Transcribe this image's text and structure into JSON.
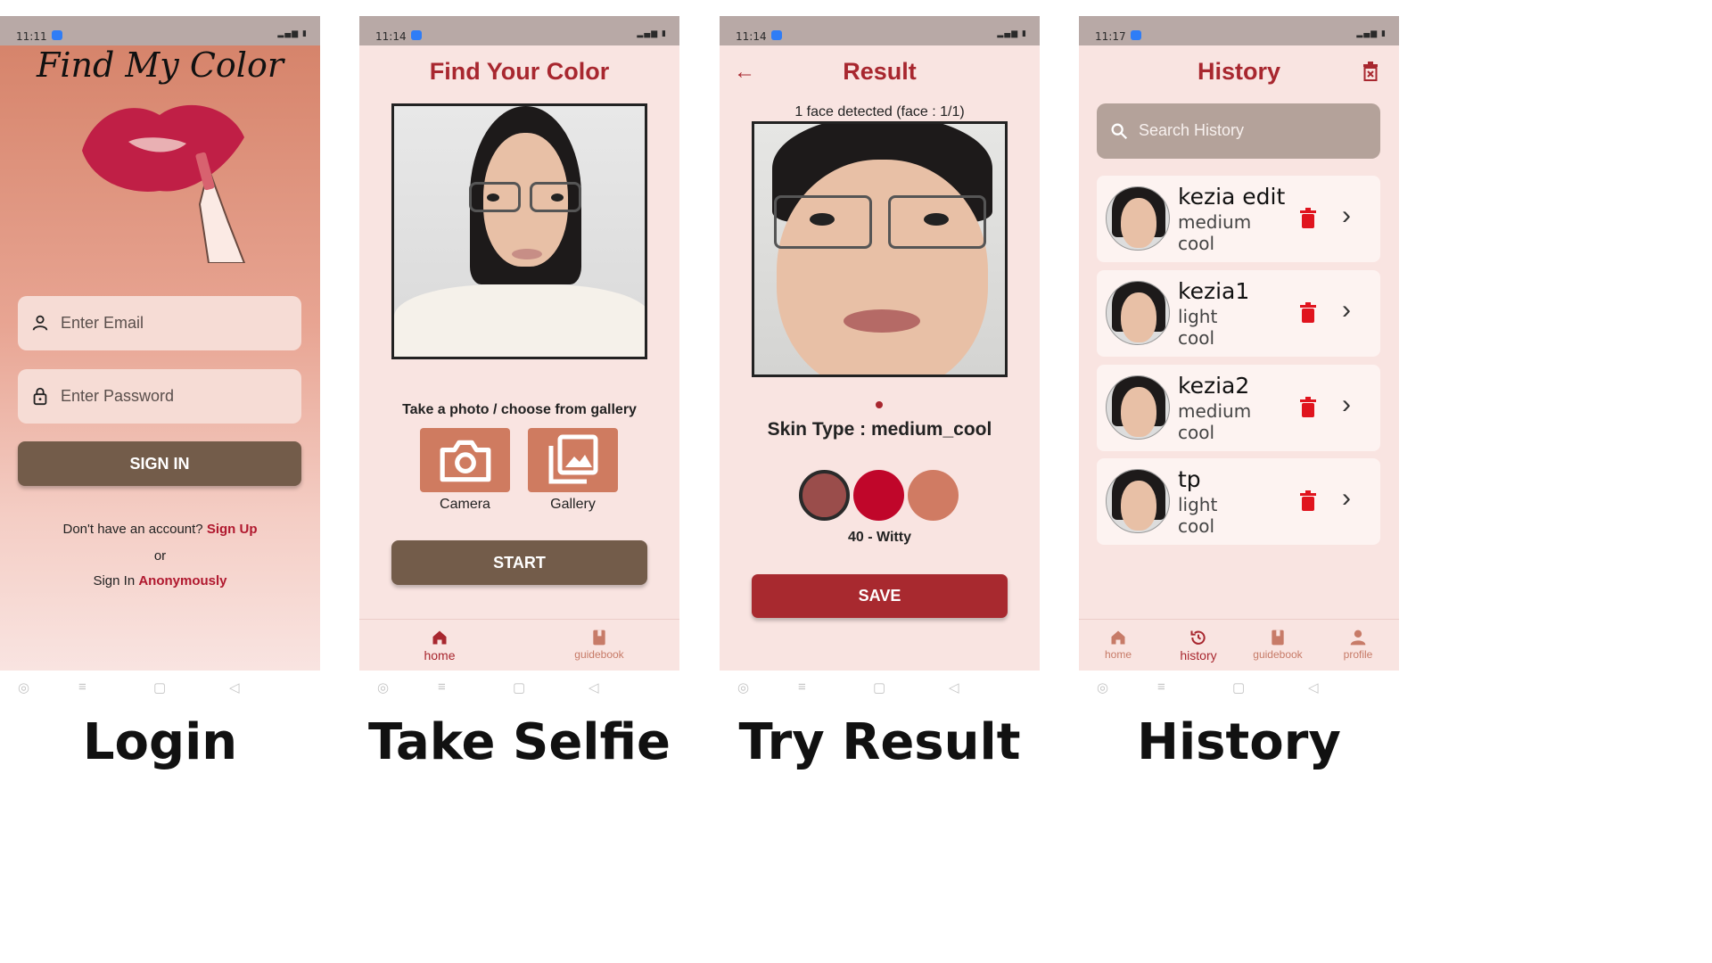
{
  "login": {
    "status_time": "11:11",
    "app_title": "Find My Color",
    "email_placeholder": "Enter Email",
    "password_placeholder": "Enter Password",
    "signin_label": "SIGN IN",
    "no_account_text": "Don't have an account?",
    "signup_link": "Sign Up",
    "or_text": "or",
    "signin_prefix": "Sign In",
    "anonymous_link": "Anonymously",
    "caption": "Login"
  },
  "selfie": {
    "status_time": "11:14",
    "title": "Find Your Color",
    "choose_label": "Take a photo / choose from gallery",
    "camera_label": "Camera",
    "gallery_label": "Gallery",
    "start_label": "START",
    "nav": {
      "home": "home",
      "guidebook": "guidebook"
    },
    "caption": "Take Selfie"
  },
  "result": {
    "status_time": "11:14",
    "title": "Result",
    "face_count": "1 face detected (face : 1/1)",
    "skin_type": "Skin Type : medium_cool",
    "swatch_colors": [
      "#9a4d4b",
      "#c0062a",
      "#d07b63"
    ],
    "shade_label": "40 - Witty",
    "save_label": "SAVE",
    "caption": "Try Result"
  },
  "history": {
    "status_time": "11:17",
    "title": "History",
    "search_placeholder": "Search History",
    "items": [
      {
        "name": "kezia edit",
        "tone": "medium",
        "undertone": "cool"
      },
      {
        "name": "kezia1",
        "tone": "light",
        "undertone": "cool"
      },
      {
        "name": "kezia2",
        "tone": "medium",
        "undertone": "cool"
      },
      {
        "name": "tp",
        "tone": "light",
        "undertone": "cool"
      }
    ],
    "nav": {
      "home": "home",
      "history": "history",
      "guidebook": "guidebook",
      "profile": "profile"
    },
    "caption": "History"
  },
  "colors": {
    "accent": "#a8272f",
    "brown_button": "#735c4a",
    "salmon": "#cf7b60",
    "delete_red": "#e0141e"
  }
}
